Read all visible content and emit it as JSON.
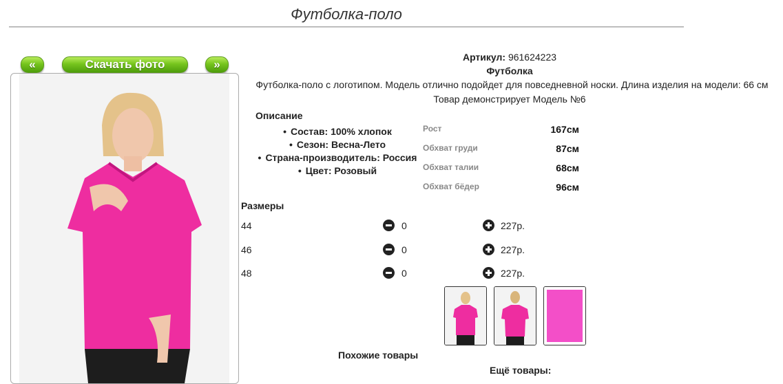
{
  "header": {
    "title": "Футболка-поло"
  },
  "gallery": {
    "prev_label": "«",
    "download_label": "Скачать фото",
    "next_label": "»"
  },
  "product": {
    "article_label": "Артикул:",
    "article_value": "961624223",
    "type": "Футболка",
    "description": "Футболка-поло с логотипом. Модель отлично подойдет для повседневной носки. Длина изделия на модели: 66 см",
    "model_note": "Товар демонстрирует Модель №6"
  },
  "details": {
    "heading": "Описание",
    "items": [
      "Состав: 100% хлопок",
      "Сезон: Весна-Лето",
      "Страна-производитель: Россия",
      "Цвет: Розовый"
    ]
  },
  "measurements": [
    {
      "label": "Рост",
      "value": "167см"
    },
    {
      "label": "Обхват груди",
      "value": "87см"
    },
    {
      "label": "Обхват талии",
      "value": "68см"
    },
    {
      "label": "Обхват бёдер",
      "value": "96см"
    }
  ],
  "sizes": {
    "heading": "Размеры",
    "rows": [
      {
        "size": "44",
        "qty": "0",
        "price": "227р."
      },
      {
        "size": "46",
        "qty": "0",
        "price": "227р."
      },
      {
        "size": "48",
        "qty": "0",
        "price": "227р."
      }
    ]
  },
  "thumbnails": [
    "front-view",
    "back-view",
    "fabric-swatch"
  ],
  "colors": {
    "accent_pink": "#ee2da0",
    "button_green": "#76c51e"
  },
  "footer": {
    "similar_label": "Похожие товары",
    "more_label": "Ещё товары:"
  }
}
